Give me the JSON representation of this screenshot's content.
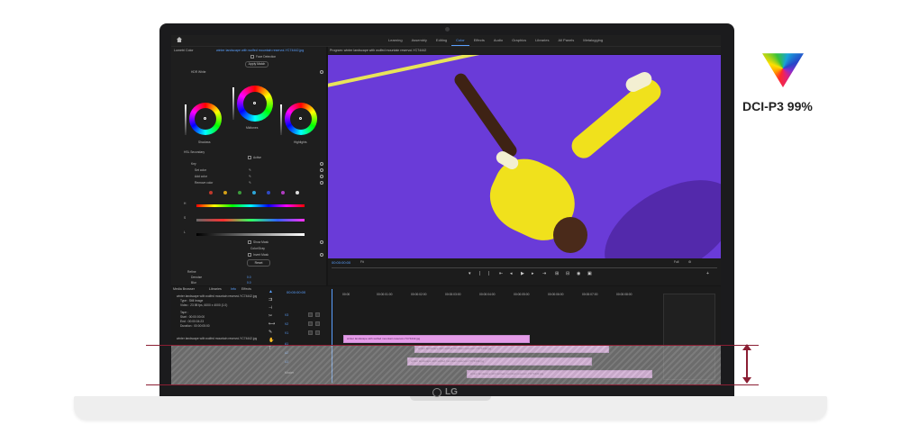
{
  "badge": {
    "text": "DCI-P3 99%"
  },
  "laptop": {
    "brand": "LG"
  },
  "app": {
    "workspaces": [
      "Learning",
      "Assembly",
      "Editing",
      "Color",
      "Effects",
      "Audio",
      "Graphics",
      "Libraries",
      "All Panels",
      "Metalogging"
    ],
    "active_workspace": "Color",
    "lumetri": {
      "tab_title": "Lumetri Color",
      "clip_tab": "winter landscape with wolfed mountain reservoi-YC74442.jpg",
      "face_detection": "Face Detection",
      "match": "Apply Match",
      "hdr_white": "HDR White",
      "wheels": [
        "Shadows",
        "Midtones",
        "Highlights"
      ],
      "hsl_title": "HSL Secondary",
      "active": "Active",
      "key": "Key",
      "set_color": "Set color",
      "add_color": "Add color",
      "remove_color": "Remove color",
      "h": "H",
      "s": "S",
      "l": "L",
      "show_mask": "Show Mask",
      "mask_mode": "Color/Gray",
      "invert_mask": "Invert Mask",
      "reset": "Reset",
      "refine": "Refine",
      "denoise": "Denoise",
      "blur": "Blur",
      "denoise_val": "0.0",
      "blur_val": "0.0"
    },
    "program": {
      "title": "Program: winter landscape with wolfed mountain reservoi-YC74442",
      "timecode": "00:00:00:00",
      "fit": "Fit",
      "quality": "Full"
    },
    "project": {
      "tabs": [
        "Media Browser",
        "Libraries",
        "Info",
        "Effects"
      ],
      "clip_name": "winter landscape with wolfed mountain reservoi-YC74442.jpg",
      "type": "Type : Still Image",
      "video": "Video : 23.98 fps, 6000 x 4000 (1.0)",
      "fields": [
        "Tape :",
        "Start : 00:00:00:00",
        "End : 00:00:04:23",
        "Duration : 00:00:05:00"
      ]
    },
    "timeline": {
      "timecode": "00:00:00:00",
      "ruler": [
        "00:00",
        "00:00:01:00",
        "00:00:02:00",
        "00:00:03:00",
        "00:00:04:00",
        "00:00:05:00",
        "00:00:06:00",
        "00:00:07:00",
        "00:00:08:00"
      ],
      "clips": [
        "winter landscape with wolfed mountain reservoi-YC74442.jpg",
        "winter landscape with wolfed mountain reservoi-YC74442.jpg",
        "winter landscape with wolfed mountain reservoi-YC74442.jpg",
        "winter landscape with wolfed mountain reservoi-YC74442.jpg"
      ],
      "track_labels": [
        "V3",
        "V2",
        "V1",
        "A1",
        "A2",
        "A3",
        "Master"
      ]
    }
  }
}
